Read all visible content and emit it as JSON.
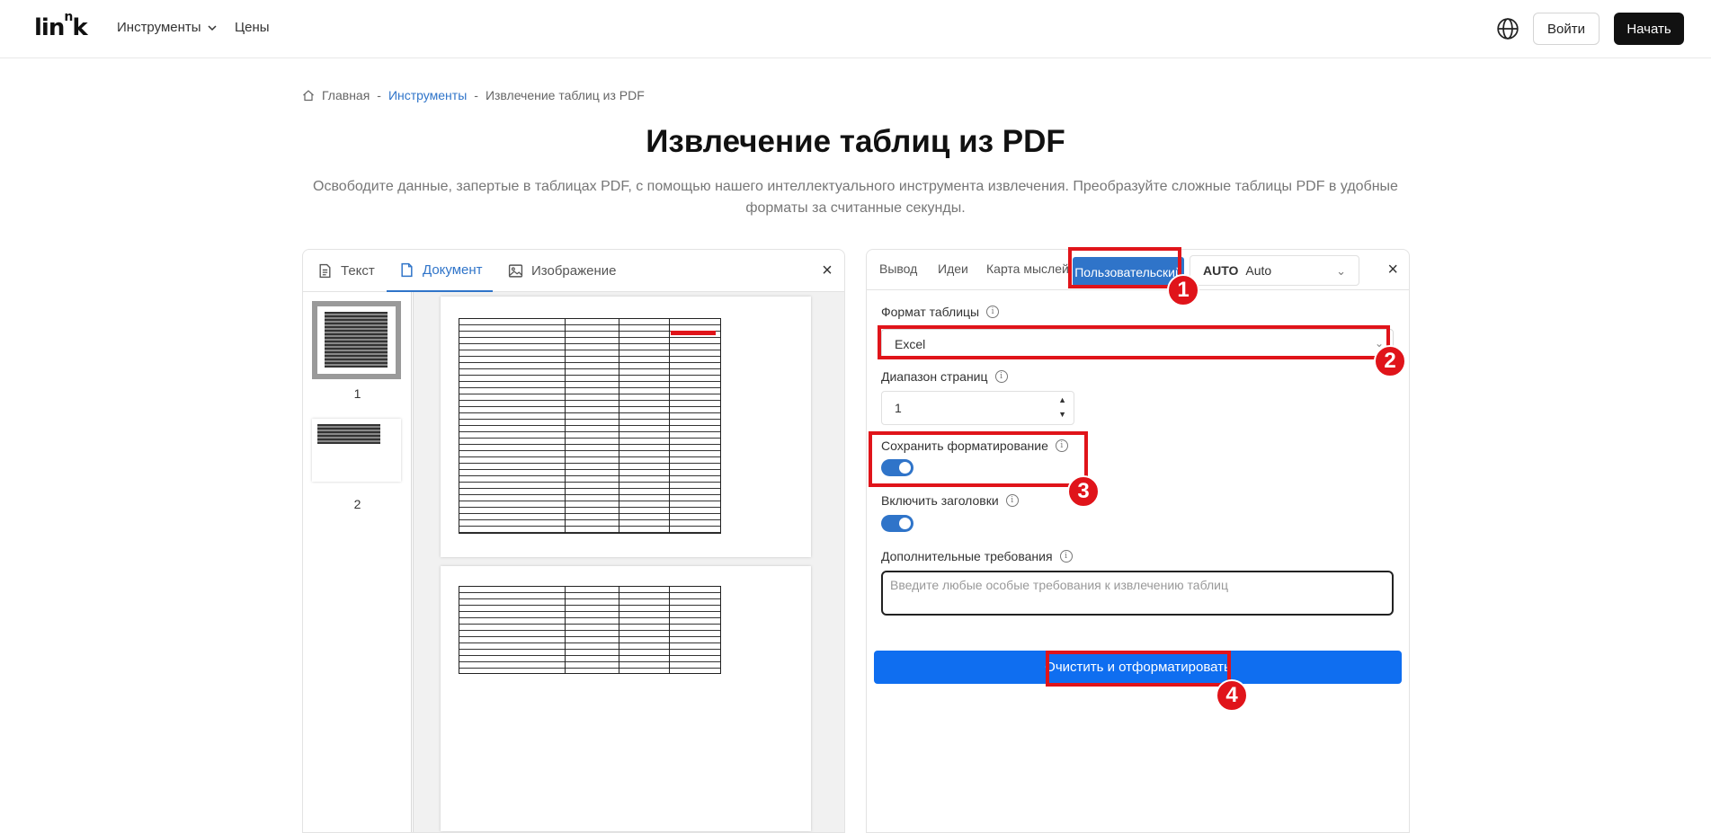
{
  "header": {
    "logo_main": "lin",
    "logo_sup": "n",
    "logo_end": "k",
    "nav_tools": "Инструменты",
    "nav_prices": "Цены",
    "login": "Войти",
    "start": "Начать"
  },
  "breadcrumb": {
    "home": "Главная",
    "sep": "-",
    "tools": "Инструменты",
    "current": "Извлечение таблиц из PDF"
  },
  "title": "Извлечение таблиц из PDF",
  "subtitle": "Освободите данные, запертые в таблицах PDF, с помощью нашего интеллектуального инструмента извлечения. Преобразуйте сложные таблицы PDF в удобные форматы за считанные секунды.",
  "left_tabs": {
    "text": "Текст",
    "document": "Документ",
    "image": "Изображение"
  },
  "thumbnails": [
    {
      "num": "1"
    },
    {
      "num": "2"
    }
  ],
  "right_tabs": {
    "output": "Вывод",
    "ideas": "Идеи",
    "mindmap": "Карта мыслей",
    "custom": "Пользовательский",
    "auto_bold": "AUTO",
    "auto_value": "Auto"
  },
  "form": {
    "format_label": "Формат таблицы",
    "format_value": "Excel",
    "range_label": "Диапазон страниц",
    "range_value": "1",
    "keep_format_label": "Сохранить форматирование",
    "headers_label": "Включить заголовки",
    "extra_label": "Дополнительные требования",
    "extra_placeholder": "Введите любые особые требования к извлечению таблиц",
    "submit": "Очистить и отформатировать"
  },
  "annotations": [
    "1",
    "2",
    "3",
    "4"
  ],
  "colors": {
    "accent": "#2f74c9",
    "submit": "#0f6ef0",
    "annotation": "#e0141a"
  }
}
